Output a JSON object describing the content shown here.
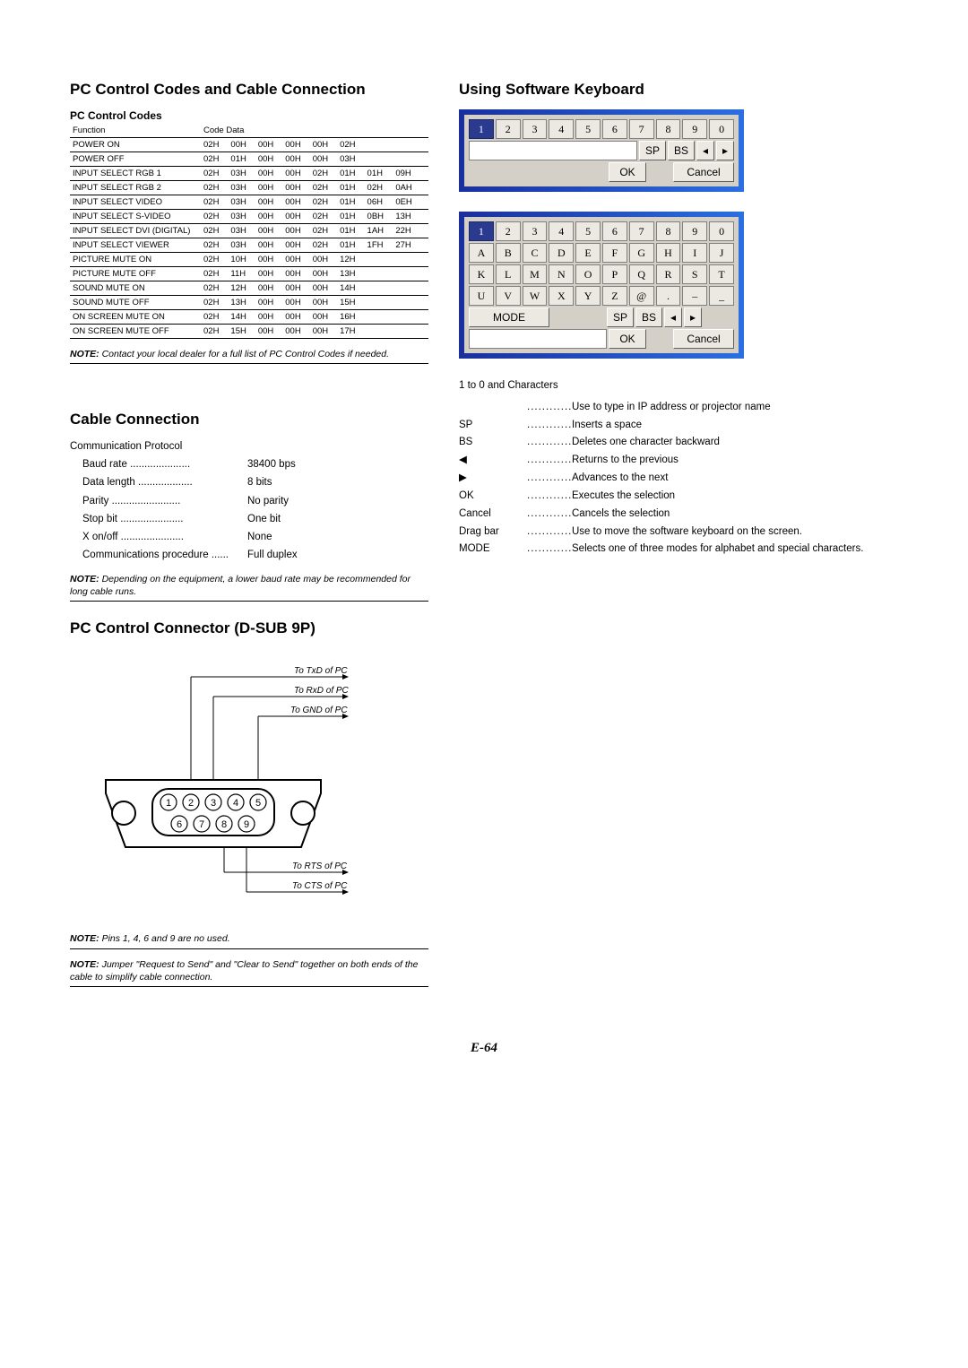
{
  "left": {
    "title_main": "PC Control Codes and Cable Connection",
    "codes_heading": "PC Control Codes",
    "table_headers": [
      "Function",
      "Code Data"
    ],
    "codes": [
      {
        "fn": "POWER ON",
        "d": [
          "02H",
          "00H",
          "00H",
          "00H",
          "00H",
          "02H",
          "",
          "",
          ""
        ]
      },
      {
        "fn": "POWER OFF",
        "d": [
          "02H",
          "01H",
          "00H",
          "00H",
          "00H",
          "03H",
          "",
          "",
          ""
        ]
      },
      {
        "fn": "INPUT SELECT RGB 1",
        "d": [
          "02H",
          "03H",
          "00H",
          "00H",
          "02H",
          "01H",
          "01H",
          "09H",
          ""
        ]
      },
      {
        "fn": "INPUT SELECT RGB 2",
        "d": [
          "02H",
          "03H",
          "00H",
          "00H",
          "02H",
          "01H",
          "02H",
          "0AH",
          ""
        ]
      },
      {
        "fn": "INPUT SELECT VIDEO",
        "d": [
          "02H",
          "03H",
          "00H",
          "00H",
          "02H",
          "01H",
          "06H",
          "0EH",
          ""
        ]
      },
      {
        "fn": "INPUT SELECT S-VIDEO",
        "d": [
          "02H",
          "03H",
          "00H",
          "00H",
          "02H",
          "01H",
          "0BH",
          "13H",
          ""
        ]
      },
      {
        "fn": "INPUT SELECT DVI (DIGITAL)",
        "d": [
          "02H",
          "03H",
          "00H",
          "00H",
          "02H",
          "01H",
          "1AH",
          "22H",
          ""
        ]
      },
      {
        "fn": "INPUT SELECT VIEWER",
        "d": [
          "02H",
          "03H",
          "00H",
          "00H",
          "02H",
          "01H",
          "1FH",
          "27H",
          ""
        ]
      },
      {
        "fn": "PICTURE MUTE ON",
        "d": [
          "02H",
          "10H",
          "00H",
          "00H",
          "00H",
          "12H",
          "",
          "",
          ""
        ]
      },
      {
        "fn": "PICTURE MUTE OFF",
        "d": [
          "02H",
          "11H",
          "00H",
          "00H",
          "00H",
          "13H",
          "",
          "",
          ""
        ]
      },
      {
        "fn": "SOUND MUTE ON",
        "d": [
          "02H",
          "12H",
          "00H",
          "00H",
          "00H",
          "14H",
          "",
          "",
          ""
        ]
      },
      {
        "fn": "SOUND MUTE OFF",
        "d": [
          "02H",
          "13H",
          "00H",
          "00H",
          "00H",
          "15H",
          "",
          "",
          ""
        ]
      },
      {
        "fn": "ON SCREEN MUTE ON",
        "d": [
          "02H",
          "14H",
          "00H",
          "00H",
          "00H",
          "16H",
          "",
          "",
          ""
        ]
      },
      {
        "fn": "ON SCREEN MUTE OFF",
        "d": [
          "02H",
          "15H",
          "00H",
          "00H",
          "00H",
          "17H",
          "",
          "",
          ""
        ]
      }
    ],
    "note1_label": "NOTE:",
    "note1": " Contact your local dealer for a full list of PC Control Codes if needed.",
    "cable_heading": "Cable Connection",
    "comm_proto_label": "Communication Protocol",
    "protocol": [
      {
        "label": "Baud rate",
        "value": "38400 bps"
      },
      {
        "label": "Data length",
        "value": "8 bits"
      },
      {
        "label": "Parity",
        "value": "No parity"
      },
      {
        "label": "Stop bit",
        "value": "One bit"
      },
      {
        "label": "X on/off",
        "value": "None"
      },
      {
        "label": "Communications procedure",
        "value": "Full duplex"
      }
    ],
    "note2_label": "NOTE:",
    "note2": " Depending on the equipment, a lower baud rate may be recommended for long cable runs.",
    "connector_heading": "PC Control Connector (D-SUB 9P)",
    "pin_labels": {
      "txd": "To TxD of PC",
      "rxd": "To RxD of PC",
      "gnd": "To GND of PC",
      "rts": "To RTS of PC",
      "cts": "To CTS of PC"
    },
    "pins_top": [
      "1",
      "2",
      "3",
      "4",
      "5"
    ],
    "pins_bottom": [
      "6",
      "7",
      "8",
      "9"
    ],
    "note3_label": "NOTE:",
    "note3": " Pins 1, 4, 6 and 9 are no used.",
    "note4_label": "NOTE:",
    "note4": " Jumper \"Request to Send\" and \"Clear to Send\" together on both ends of the cable to simplify cable connection."
  },
  "right": {
    "title": "Using Software Keyboard",
    "kbd1": {
      "row1": [
        "1",
        "2",
        "3",
        "4",
        "5",
        "6",
        "7",
        "8",
        "9",
        "0"
      ],
      "row2_labels": {
        "sp": "SP",
        "bs": "BS",
        "left": "◂",
        "right": "▸"
      },
      "row3_labels": {
        "ok": "OK",
        "cancel": "Cancel"
      }
    },
    "kbd2": {
      "row1": [
        "1",
        "2",
        "3",
        "4",
        "5",
        "6",
        "7",
        "8",
        "9",
        "0"
      ],
      "row2": [
        "A",
        "B",
        "C",
        "D",
        "E",
        "F",
        "G",
        "H",
        "I",
        "J"
      ],
      "row3": [
        "K",
        "L",
        "M",
        "N",
        "O",
        "P",
        "Q",
        "R",
        "S",
        "T"
      ],
      "row4": [
        "U",
        "V",
        "W",
        "X",
        "Y",
        "Z",
        "@",
        ".",
        "–",
        "_"
      ],
      "row5_labels": {
        "mode": "MODE",
        "sp": "SP",
        "bs": "BS",
        "left": "◂",
        "right": "▸"
      },
      "row6_labels": {
        "ok": "OK",
        "cancel": "Cancel"
      }
    },
    "defs_heading": "1 to 0 and Characters",
    "defs": [
      {
        "term": "",
        "desc": "Use to type in IP address or projector name"
      },
      {
        "term": "SP",
        "desc": "Inserts a space"
      },
      {
        "term": "BS",
        "desc": "Deletes one character backward"
      },
      {
        "term": "◀",
        "desc": "Returns to the previous"
      },
      {
        "term": "▶",
        "desc": "Advances to the next"
      },
      {
        "term": "OK",
        "desc": "Executes the selection"
      },
      {
        "term": "Cancel",
        "desc": "Cancels the selection"
      },
      {
        "term": "Drag bar",
        "desc": "Use to move the software keyboard on the screen."
      },
      {
        "term": "MODE",
        "desc": "Selects one of three modes for alphabet and special characters."
      }
    ]
  },
  "page_number": "E-64"
}
